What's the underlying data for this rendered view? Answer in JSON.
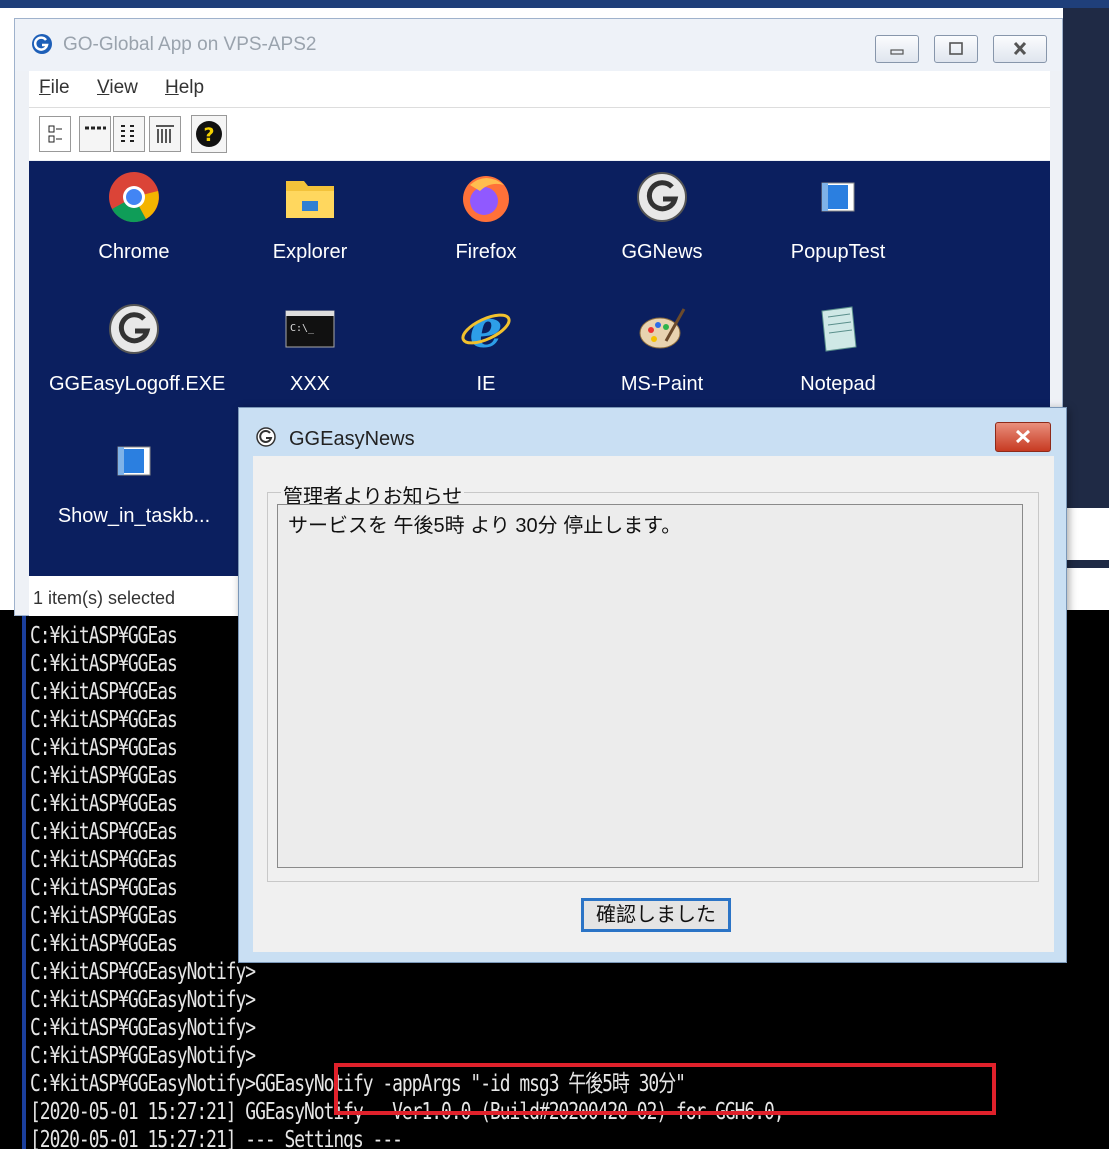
{
  "go_global_window": {
    "title": "GO-Global App on VPS-APS2",
    "menu": [
      {
        "underline": "F",
        "rest": "ile"
      },
      {
        "underline": "V",
        "rest": "iew"
      },
      {
        "underline": "H",
        "rest": "elp"
      }
    ],
    "toolbar_buttons": [
      "large-icons-view",
      "small-icons-view",
      "list-view",
      "details-view",
      "help"
    ],
    "apps": [
      {
        "label": "Chrome",
        "icon": "chrome-icon"
      },
      {
        "label": "Explorer",
        "icon": "folder-icon"
      },
      {
        "label": "Firefox",
        "icon": "firefox-icon"
      },
      {
        "label": "GGNews",
        "icon": "gg-app-icon"
      },
      {
        "label": "PopupTest",
        "icon": "window-app-icon"
      },
      {
        "label": "GGEasyLogoff.EXE",
        "icon": "gg-app-icon"
      },
      {
        "label": "XXX",
        "icon": "console-icon"
      },
      {
        "label": "IE",
        "icon": "ie-icon"
      },
      {
        "label": "MS-Paint",
        "icon": "paint-icon"
      },
      {
        "label": "Notepad",
        "icon": "notepad-icon"
      },
      {
        "label": "Show_in_taskb...",
        "icon": "window-app-icon"
      }
    ],
    "status": "1 item(s) selected"
  },
  "dialog": {
    "title": "GGEasyNews",
    "group_label": "管理者よりお知らせ",
    "message": "サービスを 午後5時 より 30分 停止します。",
    "ok_button": "確認しました"
  },
  "console": {
    "lines": [
      "C:¥kitASP¥GGEas",
      "C:¥kitASP¥GGEas",
      "C:¥kitASP¥GGEas",
      "C:¥kitASP¥GGEas",
      "C:¥kitASP¥GGEas",
      "C:¥kitASP¥GGEas",
      "C:¥kitASP¥GGEas",
      "C:¥kitASP¥GGEas",
      "C:¥kitASP¥GGEas",
      "C:¥kitASP¥GGEas",
      "C:¥kitASP¥GGEas",
      "C:¥kitASP¥GGEas",
      "C:¥kitASP¥GGEasyNotify>",
      "C:¥kitASP¥GGEasyNotify>",
      "C:¥kitASP¥GGEasyNotify>",
      "C:¥kitASP¥GGEasyNotify>",
      "C:¥kitASP¥GGEasyNotify>GGEasyNotify -appArgs \"-id msg3 午後5時 30分\"",
      "[2020-05-01 15:27:21] GGEasyNotify   Ver1.0.0 (Build#20200420-02) for GGH6.0,",
      "[2020-05-01 15:27:21] --- Settings ---"
    ]
  }
}
